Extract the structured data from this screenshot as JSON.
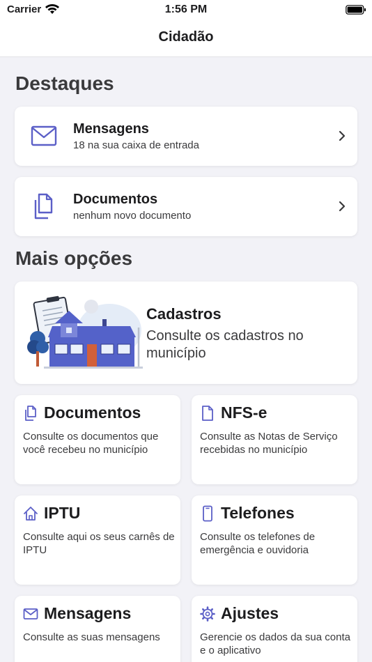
{
  "status_bar": {
    "carrier": "Carrier",
    "time": "1:56 PM"
  },
  "nav": {
    "title": "Cidadão"
  },
  "highlights": {
    "title": "Destaques",
    "items": [
      {
        "title": "Mensagens",
        "subtitle": "18 na sua caixa de entrada",
        "icon": "envelope-icon"
      },
      {
        "title": "Documentos",
        "subtitle": "nenhum novo documento",
        "icon": "documents-icon"
      }
    ]
  },
  "more": {
    "title": "Mais opções",
    "featured": {
      "title": "Cadastros",
      "description": "Consulte os cadastros no município",
      "illustration": "house-clipboard-illustration"
    },
    "tiles": [
      {
        "title": "Documentos",
        "description": "Consulte os documentos que você recebeu no município",
        "icon": "documents-icon"
      },
      {
        "title": "NFS-e",
        "description": "Consulte as Notas de Serviço recebidas no município",
        "icon": "document-icon"
      },
      {
        "title": "IPTU",
        "description": "Consulte aqui os seus carnês de IPTU",
        "icon": "house-icon"
      },
      {
        "title": "Telefones",
        "description": "Consulte os telefones de emergência e ouvidoria",
        "icon": "phone-icon"
      },
      {
        "title": "Mensagens",
        "description": "Consulte as suas mensagens",
        "icon": "envelope-icon"
      },
      {
        "title": "Ajustes",
        "description": "Gerencie os dados da sua conta e o aplicativo",
        "icon": "gear-icon"
      }
    ]
  },
  "colors": {
    "accent": "#5b5fc7",
    "background": "#f2f2f7",
    "card": "#ffffff"
  }
}
